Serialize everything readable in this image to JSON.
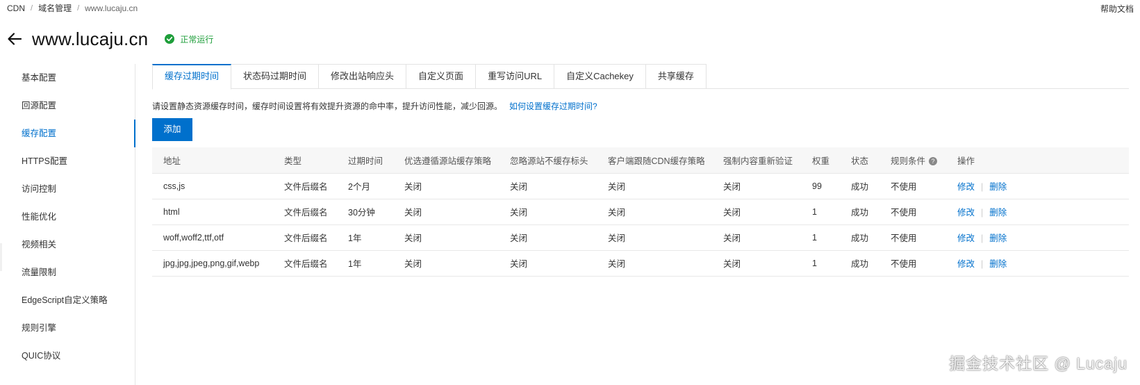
{
  "breadcrumb": [
    "CDN",
    "域名管理",
    "www.lucaju.cn"
  ],
  "help_link": "帮助文档",
  "page": {
    "title": "www.lucaju.cn",
    "status": "正常运行"
  },
  "sidebar": {
    "items": [
      {
        "label": "基本配置"
      },
      {
        "label": "回源配置"
      },
      {
        "label": "缓存配置"
      },
      {
        "label": "HTTPS配置"
      },
      {
        "label": "访问控制"
      },
      {
        "label": "性能优化"
      },
      {
        "label": "视频相关"
      },
      {
        "label": "流量限制"
      },
      {
        "label": "EdgeScript自定义策略"
      },
      {
        "label": "规则引擎"
      },
      {
        "label": "QUIC协议"
      }
    ],
    "active_index": 2
  },
  "tabs": [
    {
      "label": "缓存过期时间"
    },
    {
      "label": "状态码过期时间"
    },
    {
      "label": "修改出站响应头"
    },
    {
      "label": "自定义页面"
    },
    {
      "label": "重写访问URL"
    },
    {
      "label": "自定义Cachekey"
    },
    {
      "label": "共享缓存"
    }
  ],
  "active_tab": 0,
  "description": {
    "text": "请设置静态资源缓存时间，缓存时间设置将有效提升资源的命中率，提升访问性能，减少回源。",
    "link": "如何设置缓存过期时间?"
  },
  "add_button": "添加",
  "table": {
    "columns": [
      "地址",
      "类型",
      "过期时间",
      "优选遵循源站缓存策略",
      "忽略源站不缓存标头",
      "客户端跟随CDN缓存策略",
      "强制内容重新验证",
      "权重",
      "状态",
      "规则条件",
      "操作"
    ],
    "rows": [
      {
        "address": "css,js",
        "type": "文件后缀名",
        "expire": "2个月",
        "follow_origin": "关闭",
        "ignore_no_cache": "关闭",
        "client_follow": "关闭",
        "revalidate": "关闭",
        "weight": "99",
        "status": "成功",
        "condition": "不使用",
        "edit": "修改",
        "delete": "删除"
      },
      {
        "address": "html",
        "type": "文件后缀名",
        "expire": "30分钟",
        "follow_origin": "关闭",
        "ignore_no_cache": "关闭",
        "client_follow": "关闭",
        "revalidate": "关闭",
        "weight": "1",
        "status": "成功",
        "condition": "不使用",
        "edit": "修改",
        "delete": "删除"
      },
      {
        "address": "woff,woff2,ttf,otf",
        "type": "文件后缀名",
        "expire": "1年",
        "follow_origin": "关闭",
        "ignore_no_cache": "关闭",
        "client_follow": "关闭",
        "revalidate": "关闭",
        "weight": "1",
        "status": "成功",
        "condition": "不使用",
        "edit": "修改",
        "delete": "删除"
      },
      {
        "address": "jpg,jpg,jpeg,png,gif,webp",
        "type": "文件后缀名",
        "expire": "1年",
        "follow_origin": "关闭",
        "ignore_no_cache": "关闭",
        "client_follow": "关闭",
        "revalidate": "关闭",
        "weight": "1",
        "status": "成功",
        "condition": "不使用",
        "edit": "修改",
        "delete": "删除"
      }
    ]
  },
  "watermark": "掘金技术社区 @ Lucaju",
  "colors": {
    "primary": "#0070cc",
    "success": "#1e9e3a"
  }
}
